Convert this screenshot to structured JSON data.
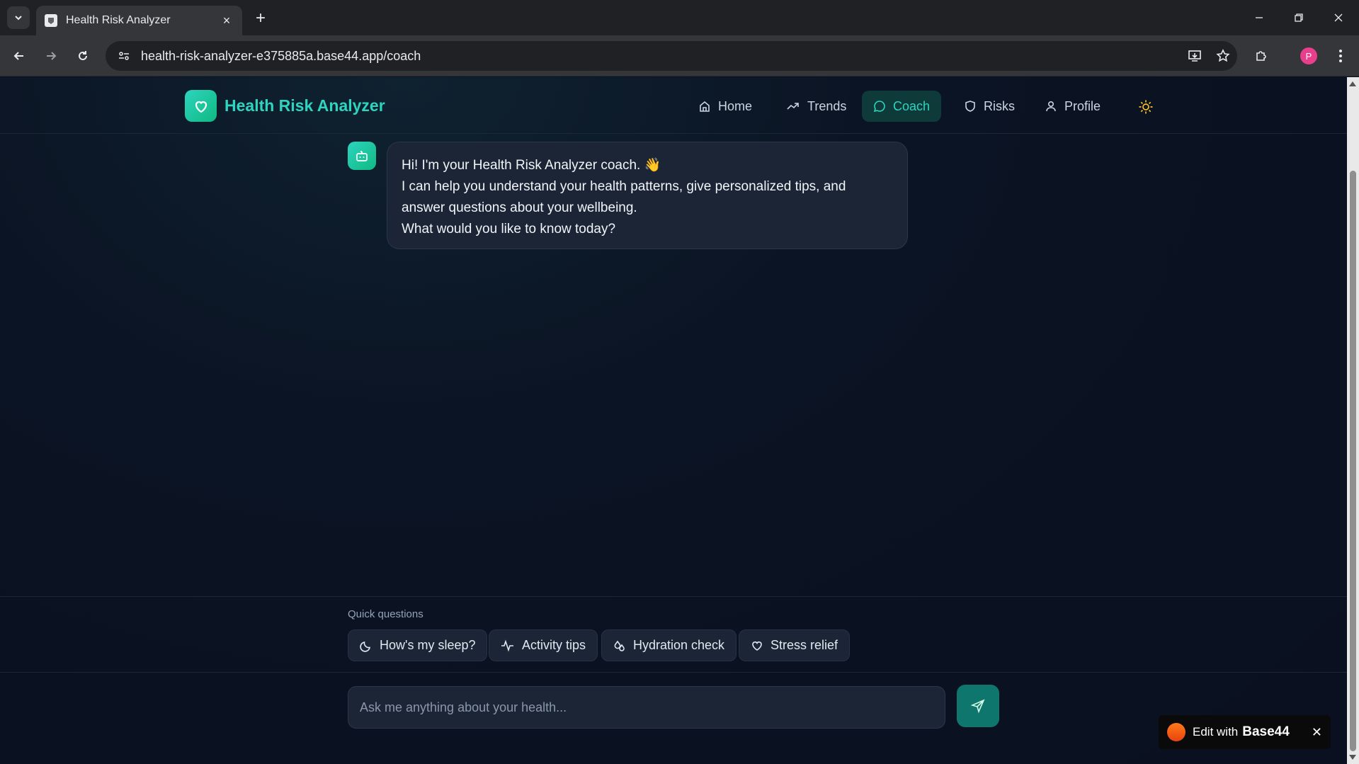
{
  "browser": {
    "tab_title": "Health Risk Analyzer",
    "url": "health-risk-analyzer-e375885a.base44.app/coach",
    "profile_initial": "P"
  },
  "app": {
    "brand": "Health Risk Analyzer",
    "nav": [
      {
        "label": "Home",
        "icon": "home-icon",
        "active": false
      },
      {
        "label": "Trends",
        "icon": "trending-up-icon",
        "active": false
      },
      {
        "label": "Coach",
        "icon": "message-circle-icon",
        "active": true
      },
      {
        "label": "Risks",
        "icon": "shield-icon",
        "active": false
      },
      {
        "label": "Profile",
        "icon": "user-icon",
        "active": false
      }
    ],
    "accent": "#2dd4bf"
  },
  "chat": {
    "messages": [
      {
        "sender": "bot",
        "lines": [
          "Hi! I'm your Health Risk Analyzer coach. 👋",
          "I can help you understand your health patterns, give personalized tips, and",
          "answer questions about your wellbeing.",
          "What would you like to know today?"
        ]
      }
    ]
  },
  "quick_questions": {
    "label": "Quick questions",
    "chips": [
      {
        "label": "How's my sleep?",
        "icon": "moon-icon"
      },
      {
        "label": "Activity tips",
        "icon": "activity-icon"
      },
      {
        "label": "Hydration check",
        "icon": "droplets-icon"
      },
      {
        "label": "Stress relief",
        "icon": "heart-icon"
      }
    ]
  },
  "composer": {
    "placeholder": "Ask me anything about your health..."
  },
  "badge": {
    "text": "Edit with",
    "brand": "Base44"
  }
}
